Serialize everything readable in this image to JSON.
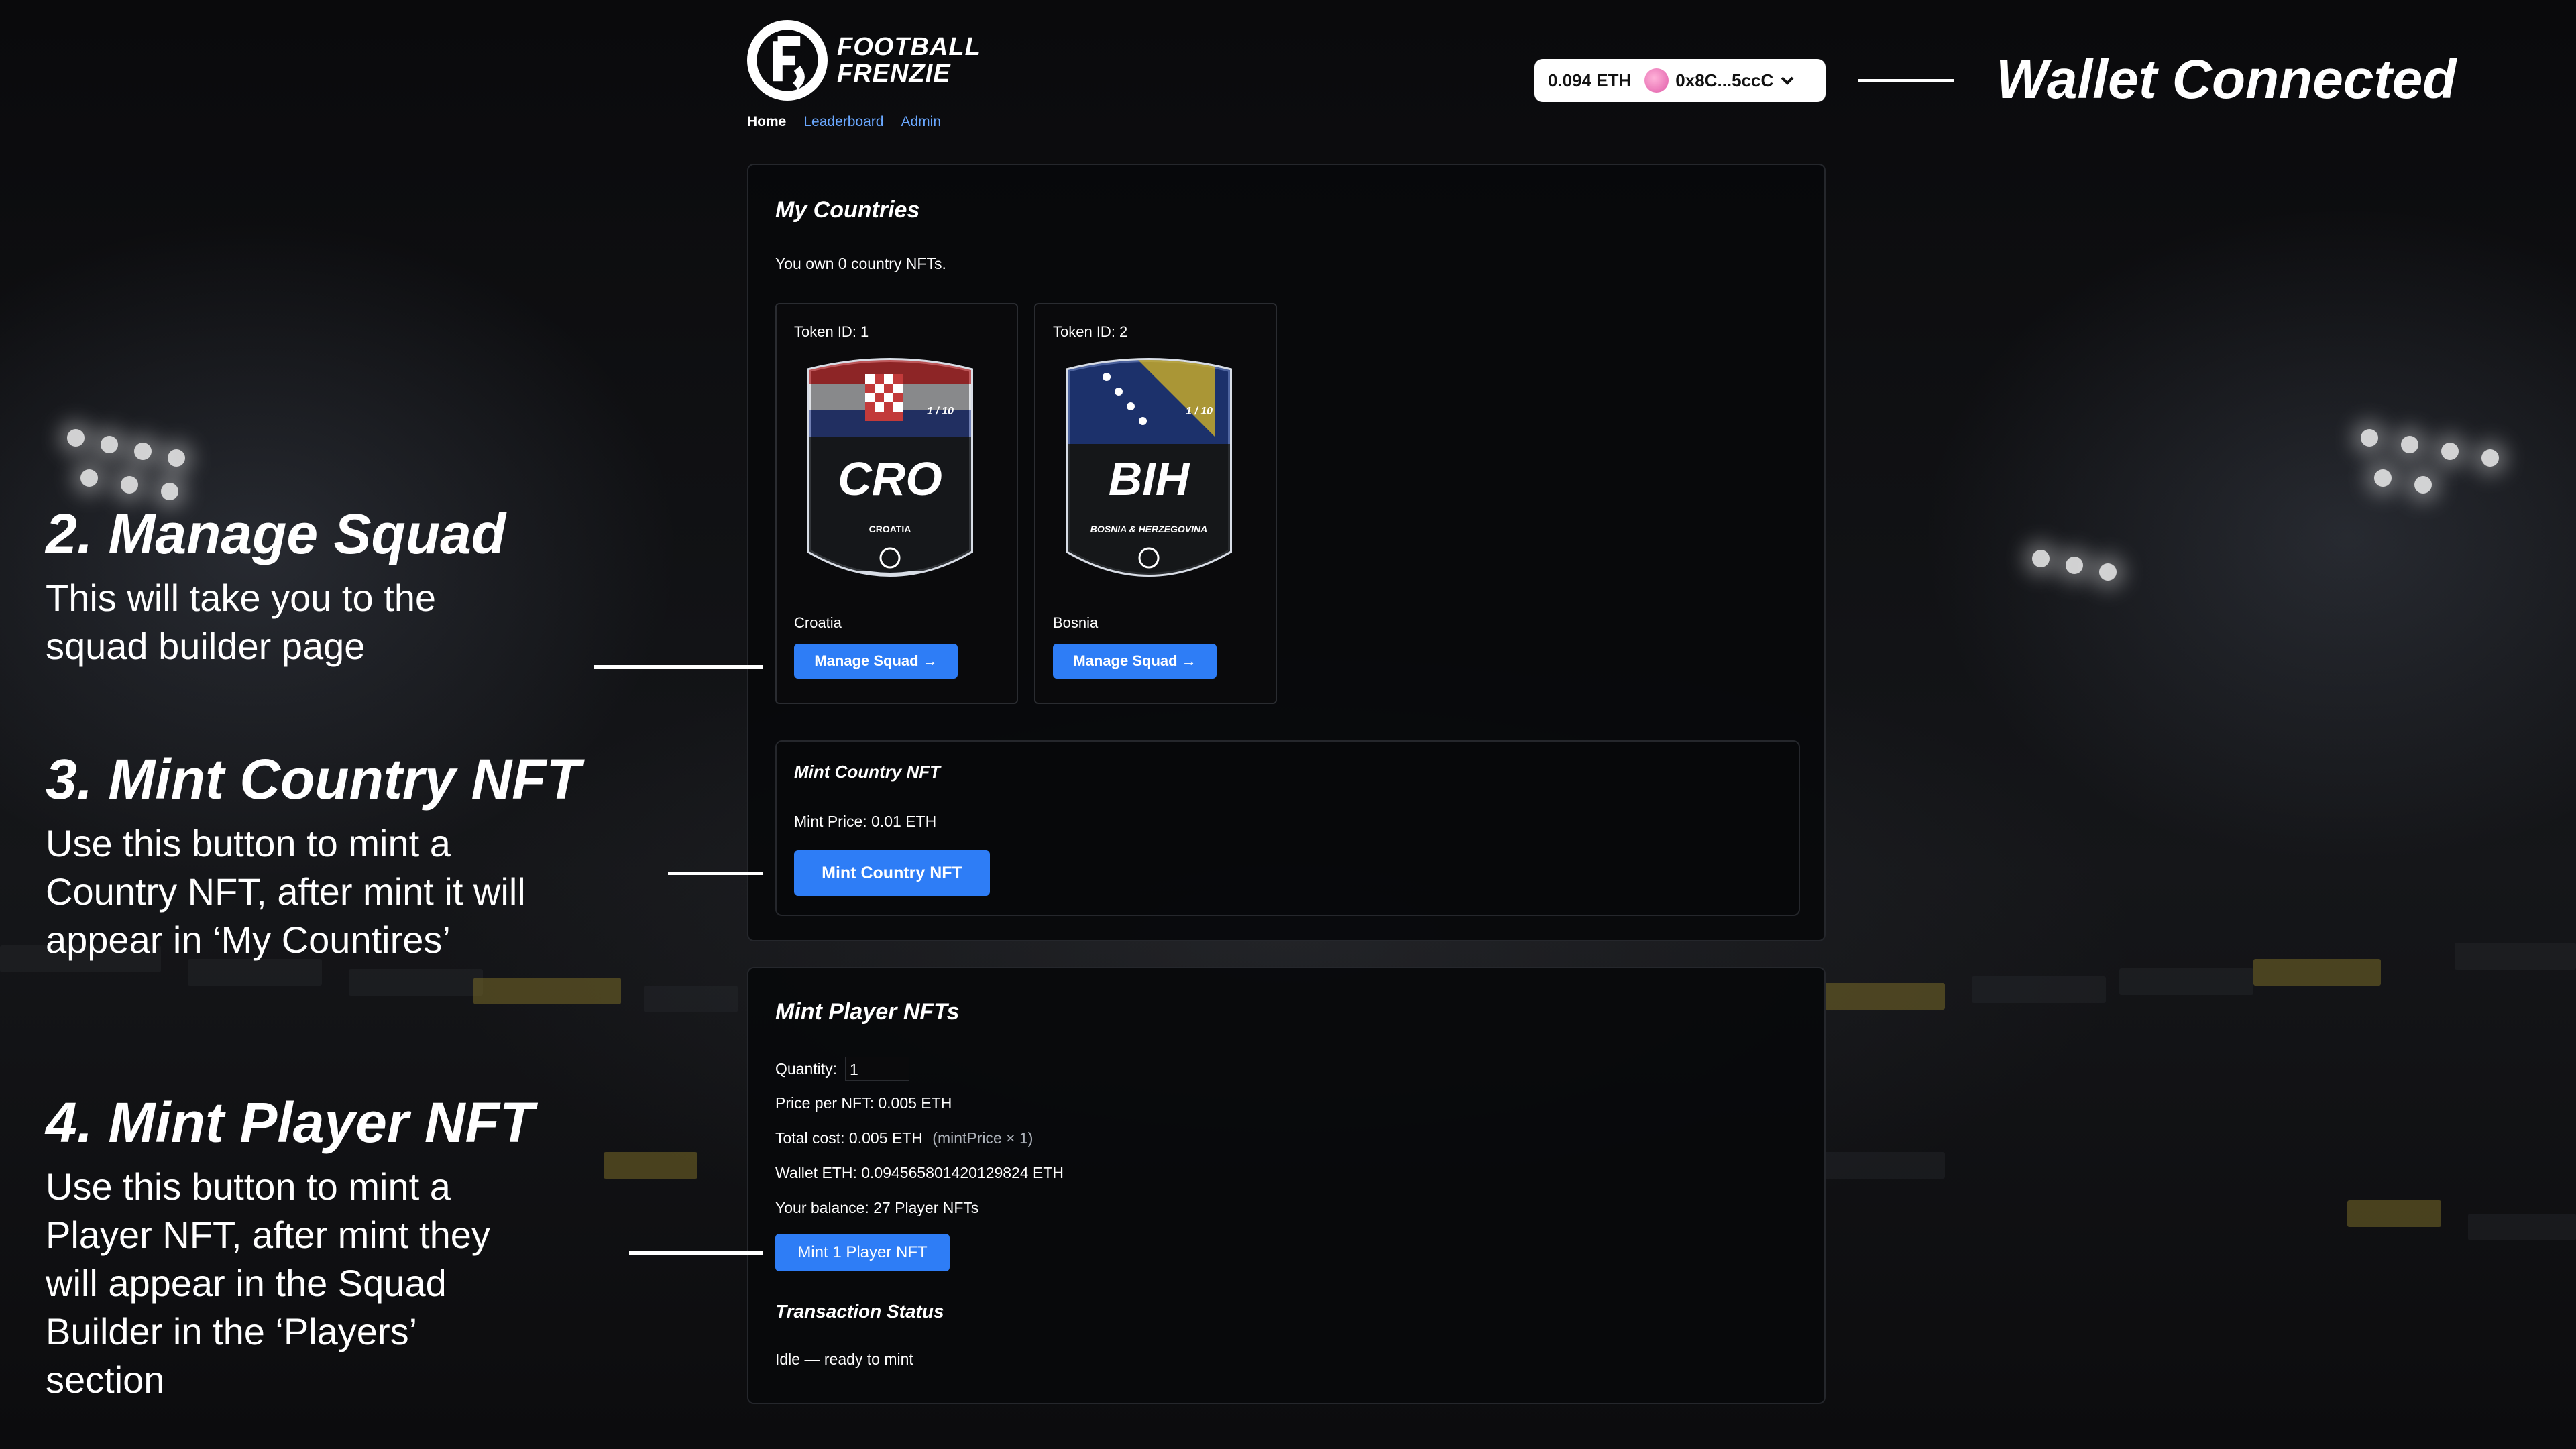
{
  "app": {
    "logo_line1": "FOOTBALL",
    "logo_line2": "FRENZIE"
  },
  "nav": {
    "home": "Home",
    "leaderboard": "Leaderboard",
    "admin": "Admin"
  },
  "wallet": {
    "balance": "0.094 ETH",
    "address": "0x8C...5ccC",
    "status_label": "Wallet Connected"
  },
  "my_countries": {
    "title": "My Countries",
    "owned_text": "You own 0 country NFTs.",
    "cards": [
      {
        "token": "Token ID: 1",
        "code": "CRO",
        "full_name": "CROATIA",
        "edition": "1 / 10",
        "name": "Croatia",
        "button": "Manage Squad →"
      },
      {
        "token": "Token ID: 2",
        "code": "BIH",
        "full_name": "BOSNIA & HERZEGOVINA",
        "edition": "1 / 10",
        "name": "Bosnia",
        "button": "Manage Squad →"
      }
    ]
  },
  "mint_country": {
    "title": "Mint Country NFT",
    "price": "Mint Price: 0.01 ETH",
    "button": "Mint Country NFT"
  },
  "mint_player": {
    "title": "Mint Player NFTs",
    "quantity_label": "Quantity:",
    "quantity_value": "1",
    "price": "Price per NFT: 0.005 ETH",
    "total_cost": "Total cost: 0.005 ETH",
    "total_formula": "(mintPrice × 1)",
    "wallet_eth": "Wallet ETH: 0.094565801420129824 ETH",
    "balance": "Your balance: 27 Player NFTs",
    "button": "Mint 1 Player NFT",
    "status_title": "Transaction Status",
    "status_text": "Idle — ready to mint"
  },
  "annotations": {
    "a2": {
      "title": "2. Manage Squad",
      "lines": [
        "This will take you to the",
        "squad builder page"
      ]
    },
    "a3": {
      "title": "3. Mint Country NFT",
      "lines": [
        "Use this button to mint a",
        "Country NFT, after mint it will",
        "appear in ‘My Countires’"
      ]
    },
    "a4": {
      "title": "4. Mint Player NFT",
      "lines": [
        "Use this button to mint a",
        "Player NFT, after mint they",
        "will appear in the Squad",
        "Builder in the ‘Players’",
        "section"
      ]
    }
  },
  "colors": {
    "accent": "#2e7df6",
    "link": "#6aa8ff",
    "background": "#0b0c0f"
  }
}
